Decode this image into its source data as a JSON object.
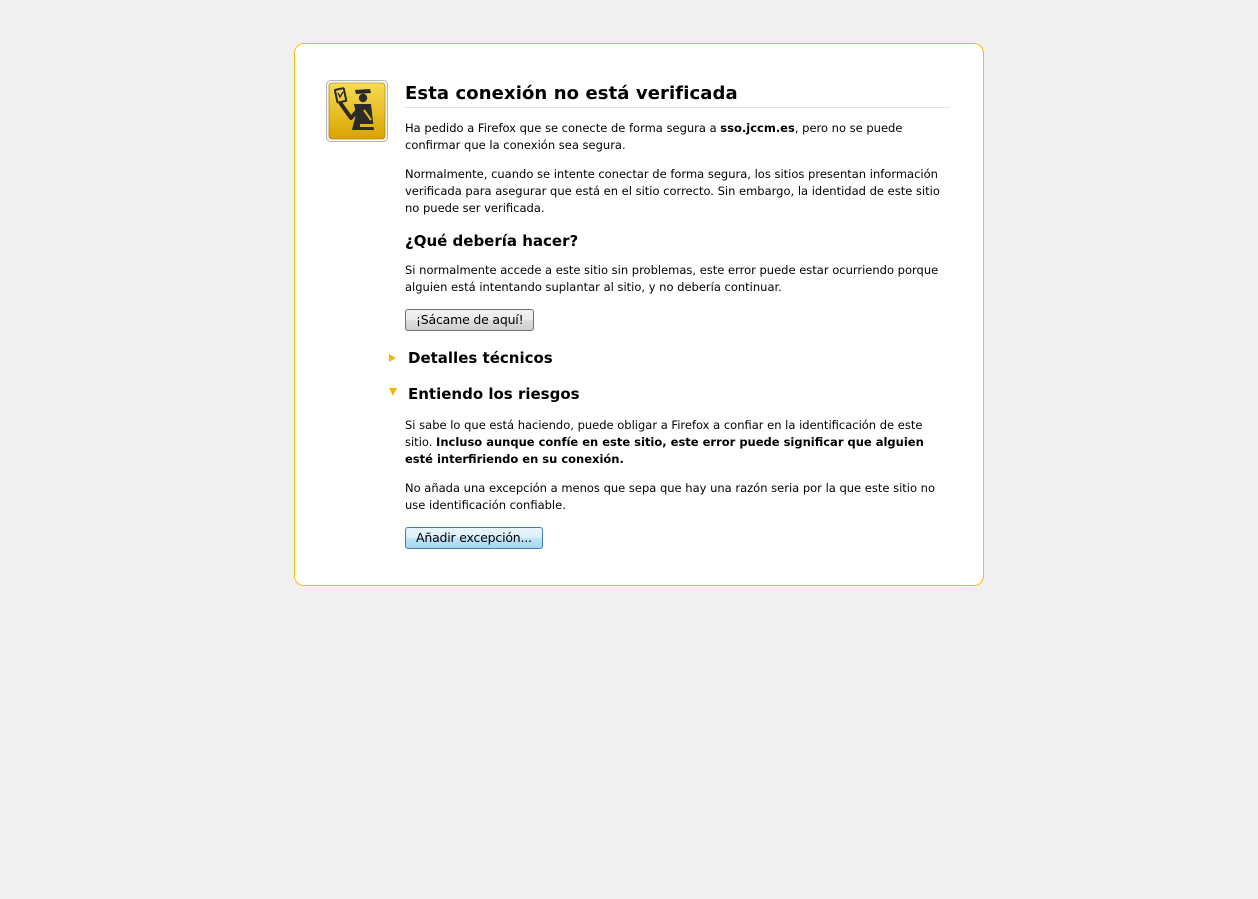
{
  "page": {
    "title": "Esta conexión no está verificada",
    "intro": {
      "text_before": "Ha pedido a Firefox que se conecte de forma segura a ",
      "host": "sso.jccm.es",
      "text_after": ", pero no se puede confirmar que la conexión sea segura."
    },
    "explanation": "Normalmente, cuando se intente conectar de forma segura, los sitios presentan información verificada para asegurar que está en el sitio correcto. Sin embargo, la identidad de este sitio no puede ser verificada.",
    "what_heading": "¿Qué debería hacer?",
    "what_text": "Si normalmente accede a este sitio sin problemas, este error puede estar ocurriendo porque alguien está intentando suplantar al sitio, y no debería continuar.",
    "get_me_out_label": "¡Sácame de aquí!",
    "technical_heading": "Detalles técnicos",
    "risks_heading": "Entiendo los riesgos",
    "risks_text": {
      "normal": "Si sabe lo que está haciendo, puede obligar a Firefox a confiar en la identificación de este sitio. ",
      "bold": "Incluso aunque confíe en este sitio, este error puede significar que alguien esté interfiriendo en su conexión."
    },
    "exception_text": "No añada una excepción a menos que sepa que hay una razón seria por la que este sitio no use identificación confiable.",
    "add_exception_label": "Añadir excepción..."
  },
  "colors": {
    "background": "#f0f0f0",
    "card_border": "#ffbd09",
    "accent_arrow": "#f5b800",
    "icon_yellow": "#e5b810"
  },
  "icons": {
    "main": "security-officer-icon",
    "technical": "expander-collapsed-icon",
    "risks": "expander-expanded-icon"
  }
}
